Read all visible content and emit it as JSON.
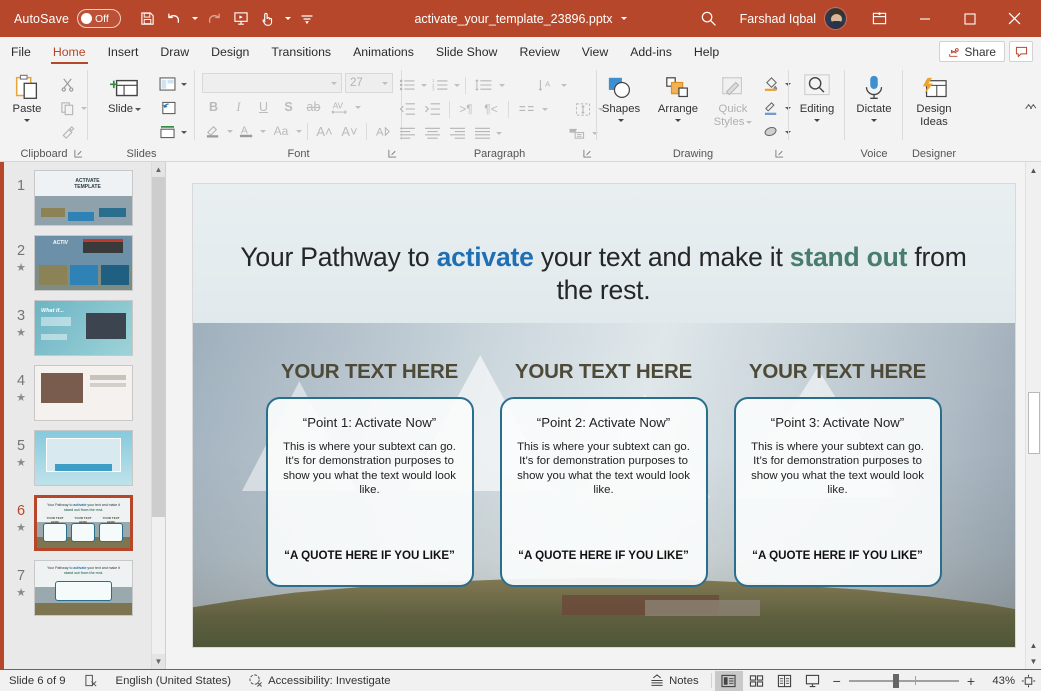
{
  "titlebar": {
    "autosave_label": "AutoSave",
    "autosave_state": "Off",
    "document_title": "activate_your_template_23896.pptx",
    "user_name": "Farshad Iqbal",
    "icons": [
      "save-icon",
      "undo-icon",
      "redo-icon",
      "start-presentation-icon",
      "touch-mode-icon",
      "customize-qat-icon"
    ],
    "brand_color": "#b7472a"
  },
  "ribbon_tabs": {
    "items": [
      {
        "label": "File"
      },
      {
        "label": "Home"
      },
      {
        "label": "Insert"
      },
      {
        "label": "Draw"
      },
      {
        "label": "Design"
      },
      {
        "label": "Transitions"
      },
      {
        "label": "Animations"
      },
      {
        "label": "Slide Show"
      },
      {
        "label": "Review"
      },
      {
        "label": "View"
      },
      {
        "label": "Add-ins"
      },
      {
        "label": "Help"
      }
    ],
    "active": "Home",
    "share_label": "Share"
  },
  "ribbon": {
    "groups": [
      {
        "name": "Clipboard",
        "label": "Clipboard",
        "buttons": [
          "Paste",
          "Cut",
          "Copy",
          "Format Painter"
        ]
      },
      {
        "name": "Slides",
        "label": "Slides",
        "buttons": [
          "New Slide",
          "Layout",
          "Reset",
          "Section"
        ]
      },
      {
        "name": "Font",
        "label": "Font",
        "font_name": "",
        "font_size": "27",
        "buttons": [
          "Bold",
          "Italic",
          "Underline",
          "Text Shadow",
          "Strikethrough",
          "Character Spacing",
          "Text Highlight Color",
          "Font Color",
          "Change Case",
          "Increase Font Size",
          "Decrease Font Size",
          "Clear All Formatting"
        ]
      },
      {
        "name": "Paragraph",
        "label": "Paragraph",
        "buttons": [
          "Bullets",
          "Numbering",
          "Line Spacing",
          "Text Direction",
          "Decrease Indent",
          "Increase Indent",
          "Align Left",
          "Center",
          "Align Right",
          "Justify",
          "Columns",
          "Align Text",
          "Convert to SmartArt"
        ]
      },
      {
        "name": "Drawing",
        "label": "Drawing",
        "buttons": [
          "Shapes",
          "Arrange",
          "Quick Styles",
          "Shape Fill",
          "Shape Outline",
          "Shape Effects"
        ]
      },
      {
        "name": "Editing",
        "label": "",
        "buttons": [
          "Editing"
        ]
      },
      {
        "name": "Voice",
        "label": "Voice",
        "buttons": [
          "Dictate"
        ]
      },
      {
        "name": "Designer",
        "label": "Designer",
        "buttons": [
          "Design Ideas"
        ]
      }
    ],
    "paste_label": "Paste",
    "new_slide_label_1": "New",
    "new_slide_label_2": "Slide",
    "shapes_label": "Shapes",
    "arrange_label": "Arrange",
    "quick_styles_label_1": "Quick",
    "quick_styles_label_2": "Styles",
    "editing_label": "Editing",
    "dictate_label": "Dictate",
    "design_ideas_label_1": "Design",
    "design_ideas_label_2": "Ideas",
    "group_labels": {
      "clipboard": "Clipboard",
      "slides": "Slides",
      "font": "Font",
      "paragraph": "Paragraph",
      "drawing": "Drawing",
      "voice": "Voice",
      "designer": "Designer"
    }
  },
  "thumbnails": {
    "selected_index": 6,
    "items": [
      {
        "number": "1",
        "starred": false
      },
      {
        "number": "2",
        "starred": true
      },
      {
        "number": "3",
        "starred": true
      },
      {
        "number": "4",
        "starred": true
      },
      {
        "number": "5",
        "starred": true
      },
      {
        "number": "6",
        "starred": true
      },
      {
        "number": "7",
        "starred": true
      }
    ]
  },
  "slide": {
    "title_parts": [
      {
        "text": "Your Pathway to ",
        "style": "normal"
      },
      {
        "text": "activate",
        "style": "blue"
      },
      {
        "text": " your text and make it ",
        "style": "normal"
      },
      {
        "text": "stand out",
        "style": "green"
      },
      {
        "text": " from the rest.",
        "style": "normal"
      }
    ],
    "title_plain": "Your Pathway to activate your text and make it stand out from the rest.",
    "columns": [
      {
        "header": "YOUR TEXT HERE",
        "card_title": "“Point 1: Activate Now”",
        "card_body": "This is where your subtext can go. It’s for demonstration purposes to show you what the text would look like.",
        "card_quote": "“A QUOTE HERE IF YOU LIKE”"
      },
      {
        "header": "YOUR TEXT HERE",
        "card_title": "“Point 2: Activate Now”",
        "card_body": "This is where your subtext can go. It’s for demonstration purposes to show you what the text would look like.",
        "card_quote": "“A QUOTE HERE IF YOU LIKE”"
      },
      {
        "header": "YOUR TEXT HERE",
        "card_title": "“Point 3: Activate Now”",
        "card_body": "This is where your subtext can go. It’s for demonstration purposes to show you what the text would look like.",
        "card_quote": "“A QUOTE HERE IF YOU LIKE”"
      }
    ],
    "accent_blue": "#1f6fb2",
    "accent_green": "#497d6b",
    "card_border_color": "#2a6e8e",
    "header_color": "#4e4a38"
  },
  "statusbar": {
    "slide_counter": "Slide 6 of 9",
    "language": "English (United States)",
    "accessibility": "Accessibility: Investigate",
    "notes_label": "Notes",
    "zoom_percent": "43%",
    "views": [
      "normal-view",
      "slide-sorter-view",
      "reading-view",
      "slide-show-view"
    ],
    "active_view": "normal-view"
  }
}
